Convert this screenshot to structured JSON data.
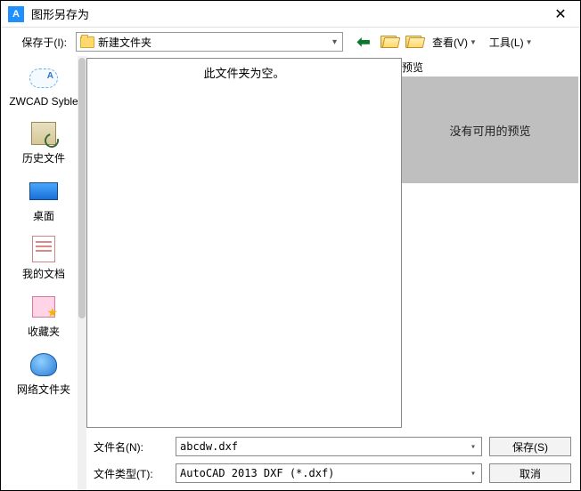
{
  "titlebar": {
    "icon_letter": "A",
    "title": "图形另存为"
  },
  "toolbar": {
    "savein_label": "保存于(I):",
    "location_name": "新建文件夹",
    "view_label": "查看(V)",
    "tools_label": "工具(L)"
  },
  "sidebar": {
    "items": [
      {
        "label": "ZWCAD Syble"
      },
      {
        "label": "历史文件"
      },
      {
        "label": "桌面"
      },
      {
        "label": "我的文档"
      },
      {
        "label": "收藏夹"
      },
      {
        "label": "网络文件夹"
      }
    ]
  },
  "filelist": {
    "empty_text": "此文件夹为空。"
  },
  "preview": {
    "label": "预览",
    "empty_text": "没有可用的预览"
  },
  "bottom": {
    "filename_label": "文件名(N):",
    "filename_value": "abcdw.dxf",
    "filetype_label": "文件类型(T):",
    "filetype_value": "AutoCAD 2013 DXF (*.dxf)",
    "save_label": "保存(S)",
    "cancel_label": "取消"
  }
}
